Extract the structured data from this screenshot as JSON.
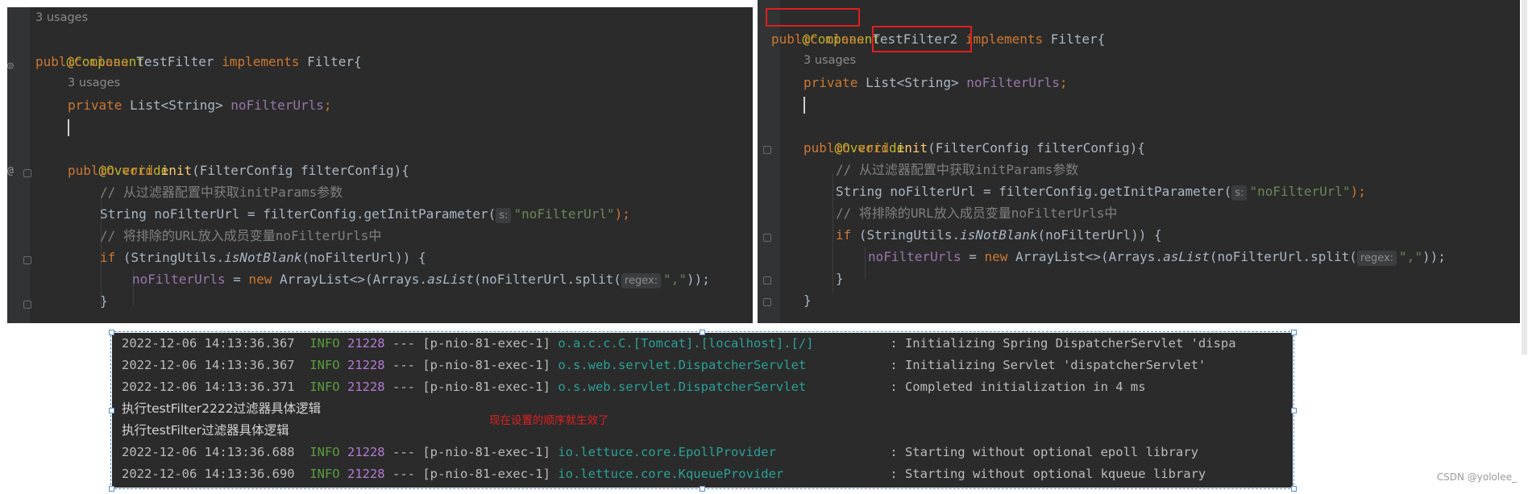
{
  "left_editor": {
    "lines": [
      {
        "usages": "3 usages"
      },
      {
        "annotation": "@Component"
      },
      {
        "kw1": "public class ",
        "name": "TestFilter ",
        "kw2": "implements ",
        "iface": "Filter{"
      },
      {
        "usages": "3 usages"
      },
      {
        "kw": "private ",
        "type": "List<String> ",
        "field": "noFilterUrls",
        "end": ";"
      },
      {
        "blank": ""
      },
      {
        "annotation": "@Override"
      },
      {
        "kw": "public void ",
        "method": "init",
        "params": "(FilterConfig filterConfig){"
      },
      {
        "comment": "// 从过滤器配置中获取initParams参数"
      },
      {
        "code": "String noFilterUrl = filterConfig.getInitParameter(",
        "hint": "s:",
        "str": "\"noFilterUrl\"",
        "end": ");"
      },
      {
        "comment": "// 将排除的URL放入成员变量noFilterUrls中"
      },
      {
        "kw": "if ",
        "pre": "(StringUtils.",
        "method": "isNotBlank",
        "post": "(noFilterUrl)) {"
      },
      {
        "field": "noFilterUrls",
        "eq": " = ",
        "kw": "new ",
        "pre": "ArrayList<>(Arrays.",
        "method": "asList",
        "post": "(noFilterUrl.split(",
        "hint": "regex:",
        "str": "\",\"",
        "end": "));"
      },
      {
        "brace": "}"
      }
    ]
  },
  "right_editor": {
    "lines": [
      {
        "annotation": "@Component"
      },
      {
        "kw1": "public class ",
        "name": "TestFilter2",
        "kw2": " implements ",
        "iface": "Filter{"
      },
      {
        "usages": "3 usages"
      },
      {
        "kw": "private ",
        "type": "List<String> ",
        "field": "noFilterUrls",
        "end": ";"
      },
      {
        "blank": ""
      },
      {
        "annotation": "@Override"
      },
      {
        "kw": "public void ",
        "method": "init",
        "params": "(FilterConfig filterConfig){"
      },
      {
        "comment": "// 从过滤器配置中获取initParams参数"
      },
      {
        "code": "String noFilterUrl = filterConfig.getInitParameter(",
        "hint": "s:",
        "str": "\"noFilterUrl\"",
        "end": ");"
      },
      {
        "comment": "// 将排除的URL放入成员变量noFilterUrls中"
      },
      {
        "kw": "if ",
        "pre": "(StringUtils.",
        "method": "isNotBlank",
        "post": "(noFilterUrl)) {"
      },
      {
        "field": "noFilterUrls",
        "eq": " = ",
        "kw": "new ",
        "pre": "ArrayList<>(Arrays.",
        "method": "asList",
        "post": "(noFilterUrl.split(",
        "hint": "regex:",
        "str": "\",\"",
        "end": "));"
      },
      {
        "brace": "}"
      },
      {
        "brace": "}"
      }
    ]
  },
  "console": {
    "logs": [
      {
        "ts": "2022-12-06 14:13:36.367",
        "level": "INFO",
        "pid": "21228",
        "thread": "--- [p-nio-81-exec-1]",
        "logger": "o.a.c.c.C.[Tomcat].[localhost].[/]",
        "msg": ": Initializing Spring DispatcherServlet 'dispa"
      },
      {
        "ts": "2022-12-06 14:13:36.367",
        "level": "INFO",
        "pid": "21228",
        "thread": "--- [p-nio-81-exec-1]",
        "logger": "o.s.web.servlet.DispatcherServlet",
        "msg": ": Initializing Servlet 'dispatcherServlet'"
      },
      {
        "ts": "2022-12-06 14:13:36.371",
        "level": "INFO",
        "pid": "21228",
        "thread": "--- [p-nio-81-exec-1]",
        "logger": "o.s.web.servlet.DispatcherServlet",
        "msg": ": Completed initialization in 4 ms"
      },
      {
        "plain": "执行testFilter2222过滤器具体逻辑"
      },
      {
        "plain": "执行testFilter过滤器具体逻辑"
      },
      {
        "ts": "2022-12-06 14:13:36.688",
        "level": "INFO",
        "pid": "21228",
        "thread": "--- [p-nio-81-exec-1]",
        "logger": "io.lettuce.core.EpollProvider",
        "msg": ": Starting without optional epoll library"
      },
      {
        "ts": "2022-12-06 14:13:36.690",
        "level": "INFO",
        "pid": "21228",
        "thread": "--- [p-nio-81-exec-1]",
        "logger": "io.lettuce.core.KqueueProvider",
        "msg": ": Starting without optional kqueue library"
      }
    ]
  },
  "annotation_note": "现在设置的顺序就生效了",
  "watermark": "CSDN @yololee_",
  "colors": {
    "editor_bg": "#2b2b2b",
    "highlight_box": "#e01e1e",
    "note_text": "#e02020"
  }
}
